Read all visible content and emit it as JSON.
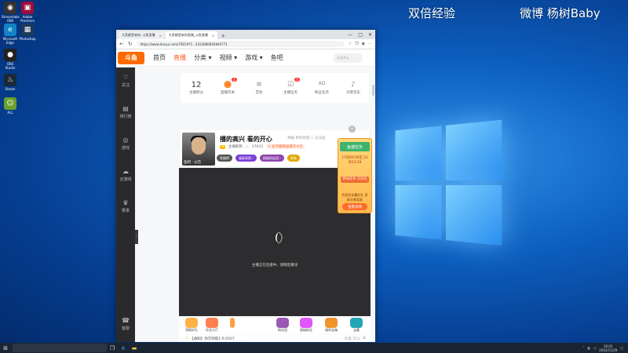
{
  "watermark": {
    "left": "双倍经验",
    "right": "微博 杨树Baby"
  },
  "desktop_icons": [
    {
      "label": "Streamlabs OBS",
      "color": "#333",
      "glyph": "◉"
    },
    {
      "label": "Adobe Premiere",
      "color": "#9b0f3c",
      "glyph": "▣"
    },
    {
      "label": "Microsoft Edge",
      "color": "#1383c5",
      "glyph": "e"
    },
    {
      "label": "Photoshop",
      "color": "#1e3a5a",
      "glyph": "▦"
    },
    {
      "label": "OBS Studio",
      "color": "#222",
      "glyph": "●"
    },
    {
      "label": "Steam",
      "color": "#1b2838",
      "glyph": "♨"
    },
    {
      "label": "ALL",
      "color": "#6a9f2b",
      "glyph": "☺"
    }
  ],
  "browser": {
    "tabs": [
      {
        "title": "大家都是来的, 斗鱼直播",
        "active": false
      },
      {
        "title": "大家都是来的直播_斗鱼直播",
        "active": true
      }
    ],
    "new_tab": "+",
    "url": "https://www.douyu.com/7601971...5433686856846771",
    "controls": [
      "—",
      "□",
      "✕"
    ]
  },
  "site": {
    "logo": "斗鱼",
    "nav": [
      {
        "label": "首页",
        "active": false
      },
      {
        "label": "直播",
        "active": true
      },
      {
        "label": "分类 ▾",
        "active": false
      },
      {
        "label": "视频 ▾",
        "active": false
      },
      {
        "label": "游戏 ▾",
        "active": false
      },
      {
        "label": "鱼吧",
        "active": false
      }
    ],
    "search_placeholder": "天天开心"
  },
  "sidebar": [
    {
      "label": "关注",
      "icon": "♡"
    },
    {
      "label": "排行榜",
      "icon": "▤"
    },
    {
      "label": "游戏",
      "icon": "◎"
    },
    {
      "label": "云游戏",
      "icon": "☁"
    },
    {
      "label": "赛事",
      "icon": "♛"
    },
    {
      "label": "客服",
      "icon": "☎"
    }
  ],
  "tools": [
    {
      "label": "主播积分",
      "value": "12",
      "icon": "",
      "badge": ""
    },
    {
      "label": "直播开关",
      "value": "",
      "icon": "⬤",
      "badge": "1"
    },
    {
      "label": "音效",
      "value": "",
      "icon": "≋",
      "badge": ""
    },
    {
      "label": "主播任务",
      "value": "",
      "icon": "☑",
      "badge": "1"
    },
    {
      "label": "粉丝任务",
      "value": "",
      "icon": "AD",
      "badge": ""
    },
    {
      "label": "点歌音乐",
      "value": "",
      "icon": "♪",
      "badge": ""
    }
  ],
  "streamer": {
    "title": "播的高兴 看的开心",
    "extra": "举报  单机热游 > 方法说",
    "avatar_caption": "鱼吧 · 公告",
    "level": "3",
    "name": "主播昵称",
    "heat": "17015",
    "promo": "V 主开播赠送豪华大礼",
    "pills": [
      {
        "label": "鱼翅榜",
        "color": "#555"
      },
      {
        "label": "福星高照 ›",
        "color": "#7b3fd6"
      },
      {
        "label": "超级粉丝团 ›",
        "color": "#8e44ad"
      },
      {
        "label": "贵族",
        "color": "#e0a800"
      }
    ]
  },
  "video": {
    "message": "主播正在连接中，请稍后重试"
  },
  "ad": {
    "banner": "鱼塘任务",
    "line1": "17日00:00至 23日23:59",
    "line2": "参加任务 已开启",
    "line3": "完成任务赢好礼 获取丰厚奖励",
    "button": "查看详情",
    "close": "×"
  },
  "gifts": [
    {
      "label": "领取好礼",
      "color": "#ffb347"
    },
    {
      "label": "任务大厅",
      "color": "#ff7f50"
    },
    {
      "label": "",
      "color": "#ff9f43"
    },
    {
      "label": "粉丝团",
      "color": "#9b59b6"
    },
    {
      "label": "超级粉丝",
      "color": "#e056fd"
    },
    {
      "label": "福利宝箱",
      "color": "#f0932b"
    },
    {
      "label": "宝藏",
      "color": "#22a6b3"
    }
  ],
  "chatbar": {
    "notice": "【通知】你可领取1-9,9507",
    "right1": "负鱼 513",
    "right2": "⚙"
  },
  "taskbar": {
    "time": "16:01",
    "date": "2022/11/29"
  }
}
